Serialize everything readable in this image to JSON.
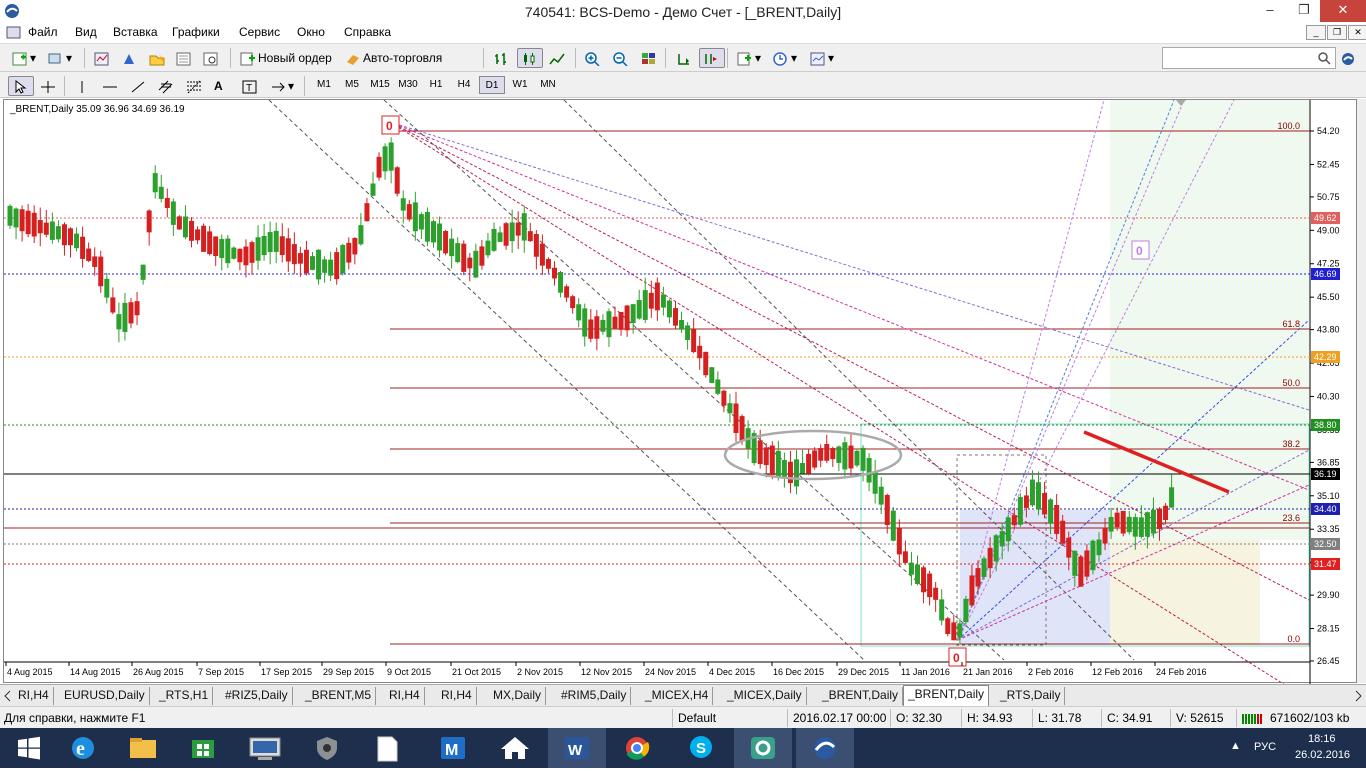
{
  "window": {
    "title": "740541: BCS-Demo - Демо Счет - [_BRENT,Daily]",
    "min": "–",
    "max": "❐",
    "close": "✕"
  },
  "menu": [
    "Файл",
    "Вид",
    "Вставка",
    "Графики",
    "Сервис",
    "Окно",
    "Справка"
  ],
  "toolbar": {
    "new_order": "Новый ордер",
    "auto_trading": "Авто-торговля"
  },
  "timeframes": [
    "M1",
    "M5",
    "M15",
    "M30",
    "H1",
    "H4",
    "D1",
    "W1",
    "MN"
  ],
  "active_timeframe": "D1",
  "chart": {
    "header": "_BRENT,Daily  35.09 36.96 34.69 36.19",
    "price_labels": [
      "54.20",
      "52.45",
      "50.75",
      "49.00",
      "47.25",
      "45.50",
      "43.80",
      "42.05",
      "40.30",
      "38.55",
      "36.85",
      "35.10",
      "33.35",
      "31.60",
      "29.90",
      "28.15",
      "26.45"
    ],
    "marked_prices": [
      {
        "value": "49.62",
        "color": "#e06060"
      },
      {
        "value": "46.69",
        "color": "#2020d0"
      },
      {
        "value": "42.29",
        "color": "#f0a020"
      },
      {
        "value": "38.80",
        "color": "#209020"
      },
      {
        "value": "36.19",
        "color": "#000000"
      },
      {
        "value": "34.40",
        "color": "#2020b0"
      },
      {
        "value": "32.50",
        "color": "#808080"
      },
      {
        "value": "31.47",
        "color": "#e02020"
      }
    ],
    "fib_labels": [
      "100.0",
      "61.8",
      "50.0",
      "38.2",
      "23.6",
      "0.0"
    ],
    "date_labels": [
      "4 Aug 2015",
      "14 Aug 2015",
      "26 Aug 2015",
      "7 Sep 2015",
      "17 Sep 2015",
      "29 Sep 2015",
      "9 Oct 2015",
      "21 Oct 2015",
      "2 Nov 2015",
      "12 Nov 2015",
      "24 Nov 2015",
      "4 Dec 2015",
      "16 Dec 2015",
      "29 Dec 2015",
      "11 Jan 2016",
      "21 Jan 2016",
      "2 Feb 2016",
      "12 Feb 2016",
      "24 Feb 2016"
    ],
    "marker_glyph": "0"
  },
  "chart_data": {
    "type": "candlestick",
    "title": "_BRENT,Daily",
    "ylim": [
      26.45,
      54.2
    ],
    "last": {
      "open": 35.09,
      "high": 36.96,
      "low": 34.69,
      "close": 36.19
    },
    "levels": [
      49.62,
      46.69,
      42.29,
      38.8,
      36.19,
      34.4,
      32.5,
      31.47
    ]
  },
  "tabs": [
    "RI,H4",
    "EURUSD,Daily",
    "_RTS,H1",
    "#RIZ5,Daily",
    "_BRENT,M5",
    "RI,H4",
    "RI,H4",
    "MX,Daily",
    "#RIM5,Daily",
    "_MICEX,H4",
    "_MICEX,Daily",
    "_BRENT,Daily",
    "_BRENT,Daily",
    "_RTS,Daily"
  ],
  "active_tab_index": 12,
  "status": {
    "help": "Для справки, нажмите F1",
    "profile": "Default",
    "datetime": "2016.02.17 00:00",
    "open": "O: 32.30",
    "high": "H: 34.93",
    "low": "L: 31.78",
    "close": "C: 34.91",
    "volume": "V: 52615",
    "traffic": "671602/103 kb"
  },
  "taskbar": {
    "lang": "РУС",
    "time": "18:16",
    "date": "26.02.2016"
  }
}
